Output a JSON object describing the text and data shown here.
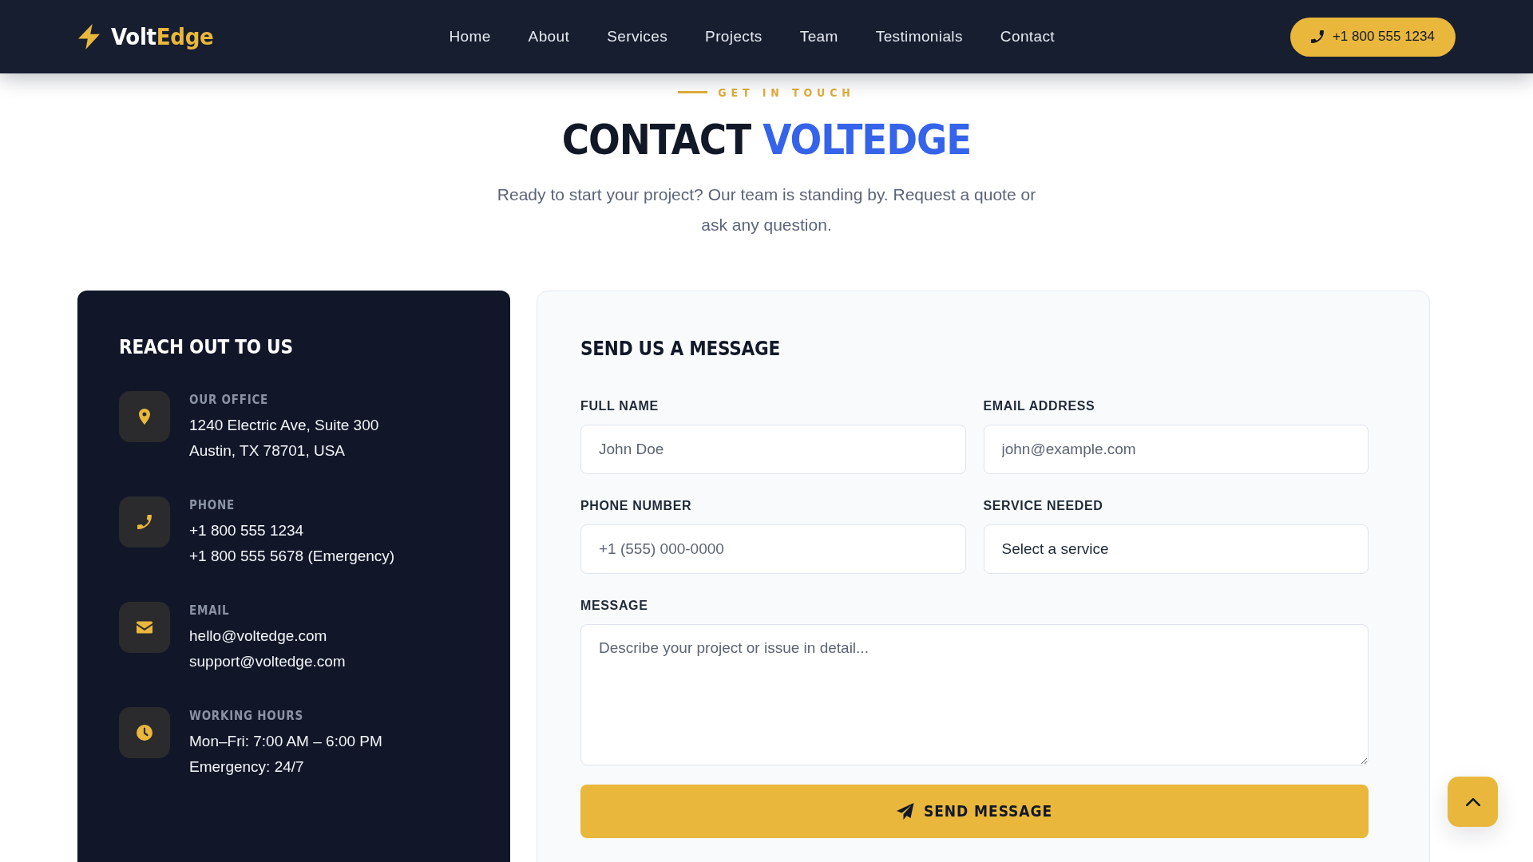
{
  "header": {
    "logo": {
      "name": "Volt",
      "accent": "Edge"
    },
    "nav": [
      "Home",
      "About",
      "Services",
      "Projects",
      "Team",
      "Testimonials",
      "Contact"
    ],
    "phone_button": "+1 800 555 1234"
  },
  "intro": {
    "eyebrow": "GET IN TOUCH",
    "title": "CONTACT",
    "title_accent": "VOLTEDGE",
    "subtitle": "Ready to start your project? Our team is standing by. Request a quote or ask any question."
  },
  "contact_panel": {
    "title": "REACH OUT TO US",
    "items": [
      {
        "kind": "location",
        "label": "OUR OFFICE",
        "lines": [
          "1240 Electric Ave, Suite 300",
          "Austin, TX 78701, USA"
        ]
      },
      {
        "kind": "phone",
        "label": "PHONE",
        "lines": [
          "+1 800 555 1234",
          "+1 800 555 5678 (Emergency)"
        ]
      },
      {
        "kind": "email",
        "label": "EMAIL",
        "lines": [
          "hello@voltedge.com",
          "support@voltedge.com"
        ]
      },
      {
        "kind": "hours",
        "label": "WORKING HOURS",
        "lines": [
          "Mon–Fri: 7:00 AM – 6:00 PM",
          "Emergency: 24/7"
        ]
      }
    ]
  },
  "form": {
    "title": "SEND US A MESSAGE",
    "fields": [
      {
        "kind": "input",
        "label": "FULL NAME",
        "placeholder": "John Doe"
      },
      {
        "kind": "input",
        "label": "EMAIL ADDRESS",
        "placeholder": "john@example.com"
      },
      {
        "kind": "input",
        "label": "PHONE NUMBER",
        "placeholder": "+1 (555) 000-0000"
      },
      {
        "kind": "select",
        "label": "SERVICE NEEDED",
        "value": "Select a service"
      },
      {
        "kind": "textarea",
        "label": "MESSAGE",
        "placeholder": "Describe your project or issue in detail..."
      }
    ],
    "submit": "SEND MESSAGE"
  }
}
